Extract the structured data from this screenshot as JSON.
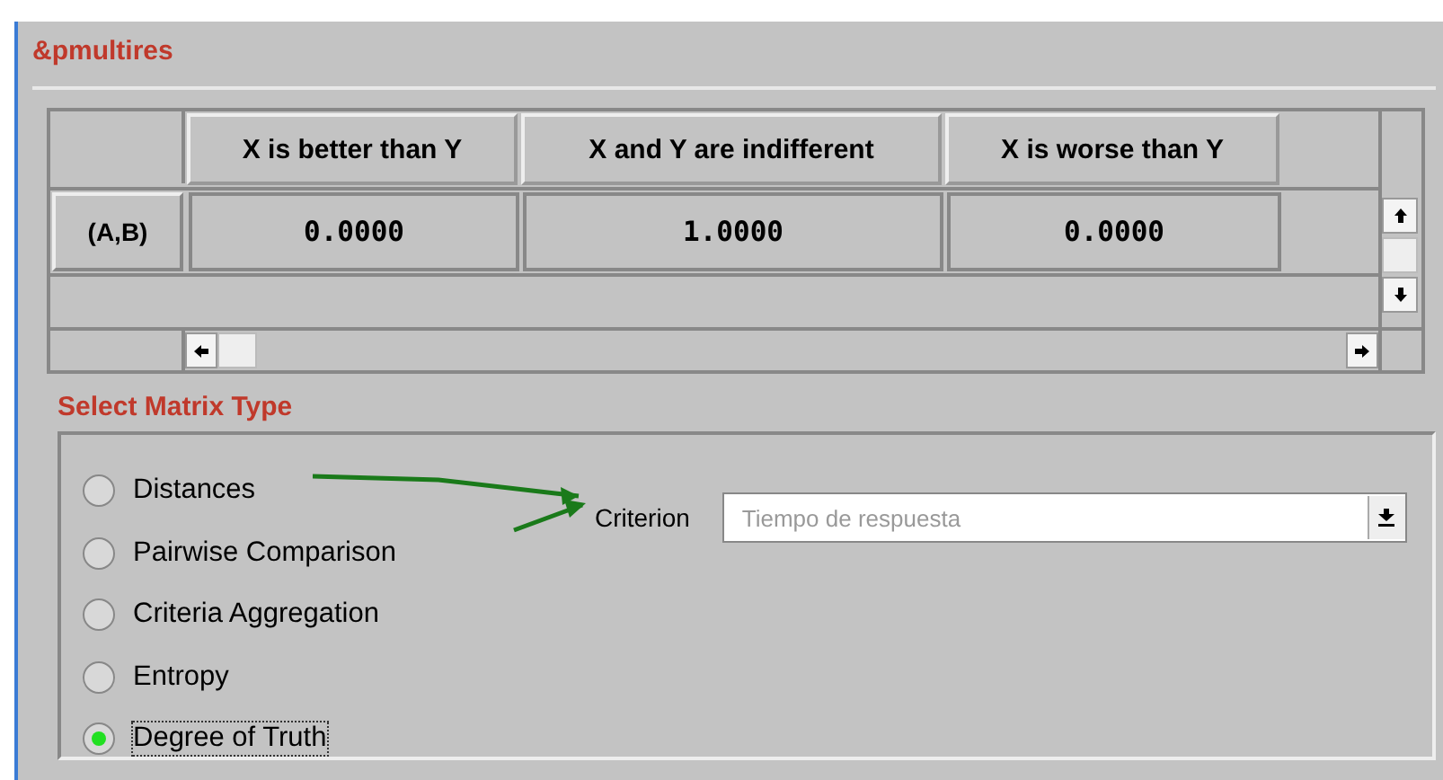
{
  "title": "&pmultires",
  "table": {
    "columns": [
      "X is better than Y",
      "X and Y are indifferent",
      "X is worse than Y"
    ],
    "rows": [
      {
        "label": "(A,B)",
        "cells": [
          "0.0000",
          "1.0000",
          "0.0000"
        ]
      }
    ]
  },
  "matrix_type": {
    "title": "Select Matrix Type",
    "options": [
      {
        "label": "Distances",
        "selected": false
      },
      {
        "label": "Pairwise Comparison",
        "selected": false
      },
      {
        "label": "Criteria Aggregation",
        "selected": false
      },
      {
        "label": "Entropy",
        "selected": false
      },
      {
        "label": "Degree of Truth",
        "selected": true
      }
    ],
    "criterion": {
      "label": "Criterion",
      "value": "Tiempo de respuesta",
      "disabled": true
    }
  }
}
